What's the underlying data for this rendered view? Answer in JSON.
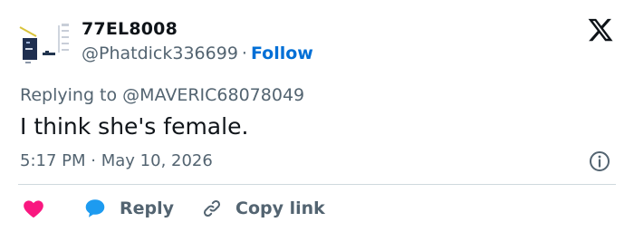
{
  "author": {
    "display_name": "77EL8008",
    "handle": "@Phatdick336699",
    "separator": "·",
    "follow_label": "Follow"
  },
  "reply_context": {
    "prefix": "Replying to",
    "target": "@MAVERIC68078049"
  },
  "tweet": {
    "text": "I think she's female.",
    "time": "5:17 PM",
    "separator": "·",
    "date": "May 10, 2026"
  },
  "actions": {
    "reply_label": "Reply",
    "copy_label": "Copy link"
  },
  "icons": {
    "brand": "x-logo-icon",
    "info": "info-icon",
    "like": "heart-icon",
    "reply": "speech-bubble-icon",
    "copy": "link-icon"
  },
  "colors": {
    "text": "#0f1419",
    "secondary": "#536471",
    "link": "#006fd6",
    "like": "#f91880",
    "reply": "#1d9bf0",
    "divider": "#cfd9de"
  }
}
